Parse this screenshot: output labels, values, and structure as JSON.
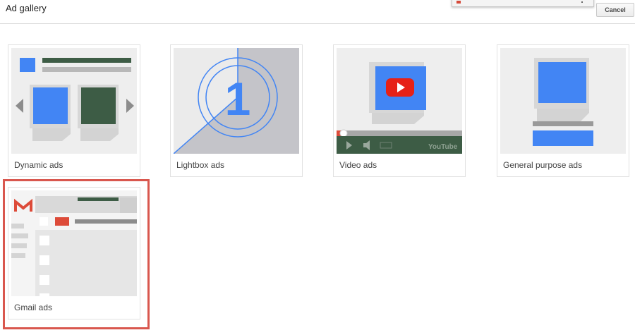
{
  "dialog": {
    "title": "Ad gallery",
    "cancel_label": "Cancel"
  },
  "cards": [
    {
      "label": "Dynamic ads"
    },
    {
      "label": "Lightbox ads",
      "thumb_numeral": "1"
    },
    {
      "label": "Video ads",
      "thumb_brand": "YouTube"
    },
    {
      "label": "General purpose ads"
    },
    {
      "label": "Gmail ads",
      "selected": true
    }
  ],
  "colors": {
    "accent_blue": "#4285f4",
    "dark_green": "#3d5c45",
    "youtube_red": "#e62117",
    "gmail_red": "#dd4b39",
    "selection_border": "#d9574e"
  }
}
